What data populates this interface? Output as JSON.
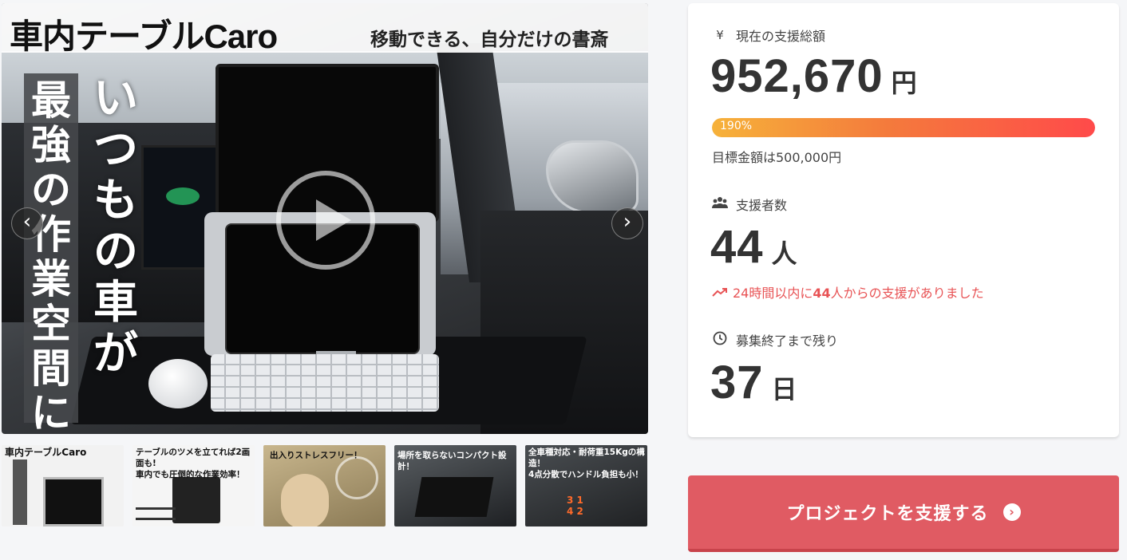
{
  "media": {
    "title": "車内テーブルCaro",
    "subtitle": "移動できる、自分だけの書斎",
    "vertical_right": "いつもの車が",
    "vertical_left": "最強の作業空間に",
    "prev_icon": "chevron-left-icon",
    "next_icon": "chevron-right-icon",
    "play_icon": "play-icon"
  },
  "thumbnails": [
    {
      "caption": "車内テーブルCaro"
    },
    {
      "caption": "テーブルのツメを立てれば2画面も!\n車内でも圧倒的な作業効率！"
    },
    {
      "caption": "出入りストレスフリー！"
    },
    {
      "caption": "場所を取らないコンパクト設計！"
    },
    {
      "caption": "全車種対応・耐荷重15Kgの構造！\n4点分散でハンドル負担も小！"
    }
  ],
  "stats": {
    "total_label": "現在の支援総額",
    "total_icon": "yen-icon",
    "total_value": "952,670",
    "total_unit": "円",
    "progress_percent": 190,
    "progress_text": "190%",
    "goal_text": "目標金額は500,000円",
    "supporters_label": "支援者数",
    "supporters_icon": "users-icon",
    "supporters_value": "44",
    "supporters_unit": "人",
    "trend_icon": "trending-up-icon",
    "trend_prefix": "24時間以内に",
    "trend_count": "44",
    "trend_suffix": "人からの支援がありました",
    "remaining_label": "募集終了まで残り",
    "remaining_icon": "clock-icon",
    "remaining_value": "37",
    "remaining_unit": "日"
  },
  "cta": {
    "label": "プロジェクトを支援する",
    "icon": "chevron-circle-right-icon"
  },
  "colors": {
    "cta": "#e05b63",
    "trend": "#e85355",
    "progress_start": "#f6b23a",
    "progress_end": "#ff4a4a"
  }
}
